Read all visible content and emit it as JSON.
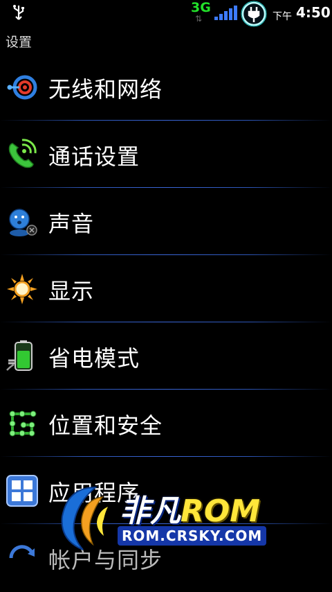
{
  "status_bar": {
    "network": "3G",
    "ampm": "下午",
    "time": "4:50"
  },
  "title": "设置",
  "menu": [
    {
      "label": "无线和网络",
      "icon": "wireless-network-icon"
    },
    {
      "label": "通话设置",
      "icon": "phone-call-icon"
    },
    {
      "label": "声音",
      "icon": "sound-icon"
    },
    {
      "label": "显示",
      "icon": "display-sun-icon"
    },
    {
      "label": "省电模式",
      "icon": "battery-saver-icon"
    },
    {
      "label": "位置和安全",
      "icon": "location-security-icon"
    },
    {
      "label": "应用程序",
      "icon": "applications-icon"
    },
    {
      "label": "帐户与同步",
      "icon": "accounts-sync-icon"
    }
  ],
  "watermark": {
    "brand_cn": "非凡",
    "brand_rom": "ROM",
    "url": "ROM.CRSKY.COM"
  },
  "colors": {
    "background": "#000000",
    "divider": "#3a66d8",
    "network_3g": "#22e02a"
  }
}
